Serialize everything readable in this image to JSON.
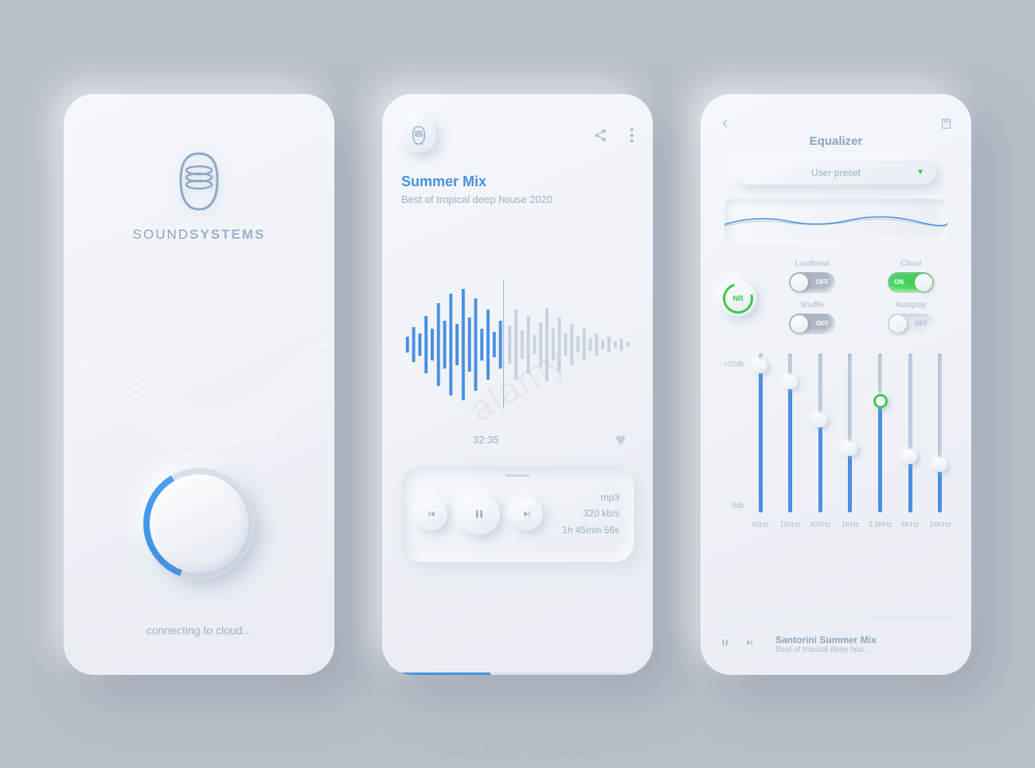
{
  "screen1": {
    "brand_light": "SOUND",
    "brand_bold": "SYSTEMS",
    "status": "connecting to cloud..."
  },
  "screen2": {
    "title": "Summer Mix",
    "subtitle": "Best of tropical deep house 2020",
    "elapsed": "32:35",
    "format": "mp3",
    "bitrate": "320 kb/s",
    "duration": "1h 45min 56s"
  },
  "screen3": {
    "header": "Equalizer",
    "preset": "User preset",
    "nr": "NR",
    "toggles": {
      "loudness": {
        "label": "Loudness",
        "state": "OFF"
      },
      "cloud": {
        "label": "Cloud",
        "state": "ON"
      },
      "shuffle": {
        "label": "Shuffle",
        "state": "OFF"
      },
      "autoplay": {
        "label": "Autoplay",
        "state": "OFF"
      }
    },
    "scale_top": "+10db",
    "scale_bot": "0db",
    "bands": [
      {
        "freq": "65Hz",
        "pct": 92
      },
      {
        "freq": "160Hz",
        "pct": 82
      },
      {
        "freq": "400Hz",
        "pct": 58
      },
      {
        "freq": "1KHz",
        "pct": 40
      },
      {
        "freq": "2.5KHz",
        "pct": 70,
        "green": true
      },
      {
        "freq": "6KHz",
        "pct": 35
      },
      {
        "freq": "14KHz",
        "pct": 30
      }
    ],
    "now_title": "Santorini Summer Mix",
    "now_sub": "Best of tropical deep hou..."
  },
  "watermark": {
    "brand": "alamy",
    "id1": "Image ID: 2RE4KJX",
    "id2": "www.alamy.com"
  }
}
